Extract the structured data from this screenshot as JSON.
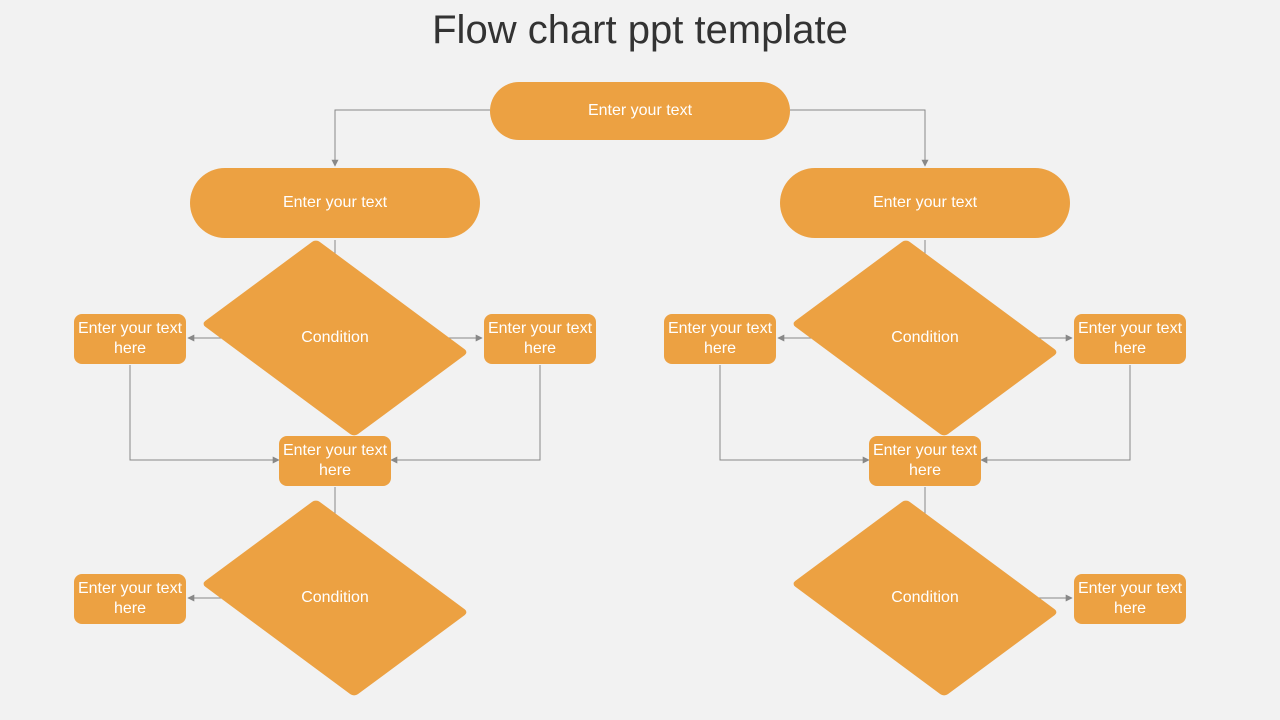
{
  "title": "Flow chart ppt template",
  "colors": {
    "accent": "#eca142",
    "line": "#888888",
    "bg": "#f2f2f2"
  },
  "chart_data": {
    "type": "flowchart",
    "nodes": [
      {
        "id": "top",
        "shape": "terminator",
        "label": "Enter your text"
      },
      {
        "id": "L_term",
        "shape": "terminator",
        "label": "Enter your text"
      },
      {
        "id": "R_term",
        "shape": "terminator",
        "label": "Enter your text"
      },
      {
        "id": "L_cond1",
        "shape": "decision",
        "label": "Condition"
      },
      {
        "id": "R_cond1",
        "shape": "decision",
        "label": "Condition"
      },
      {
        "id": "L_box_l",
        "shape": "process",
        "label": "Enter your text here"
      },
      {
        "id": "L_box_r",
        "shape": "process",
        "label": "Enter your text here"
      },
      {
        "id": "R_box_l",
        "shape": "process",
        "label": "Enter your text here"
      },
      {
        "id": "R_box_r",
        "shape": "process",
        "label": "Enter your text here"
      },
      {
        "id": "L_mid",
        "shape": "process",
        "label": "Enter your text here"
      },
      {
        "id": "R_mid",
        "shape": "process",
        "label": "Enter your text here"
      },
      {
        "id": "L_cond2",
        "shape": "decision",
        "label": "Condition"
      },
      {
        "id": "R_cond2",
        "shape": "decision",
        "label": "Condition"
      },
      {
        "id": "L_box_bl",
        "shape": "process",
        "label": "Enter your text here"
      },
      {
        "id": "R_box_br",
        "shape": "process",
        "label": "Enter your text here"
      }
    ],
    "edges": [
      {
        "from": "top",
        "to": "L_term"
      },
      {
        "from": "top",
        "to": "R_term"
      },
      {
        "from": "L_term",
        "to": "L_cond1"
      },
      {
        "from": "R_term",
        "to": "R_cond1"
      },
      {
        "from": "L_cond1",
        "to": "L_box_l"
      },
      {
        "from": "L_cond1",
        "to": "L_box_r"
      },
      {
        "from": "R_cond1",
        "to": "R_box_l"
      },
      {
        "from": "R_cond1",
        "to": "R_box_r"
      },
      {
        "from": "L_box_l",
        "to": "L_mid"
      },
      {
        "from": "L_box_r",
        "to": "L_mid"
      },
      {
        "from": "R_box_l",
        "to": "R_mid"
      },
      {
        "from": "R_box_r",
        "to": "R_mid"
      },
      {
        "from": "L_mid",
        "to": "L_cond2"
      },
      {
        "from": "R_mid",
        "to": "R_cond2"
      },
      {
        "from": "L_cond2",
        "to": "L_box_bl"
      },
      {
        "from": "R_cond2",
        "to": "R_box_br"
      }
    ]
  }
}
